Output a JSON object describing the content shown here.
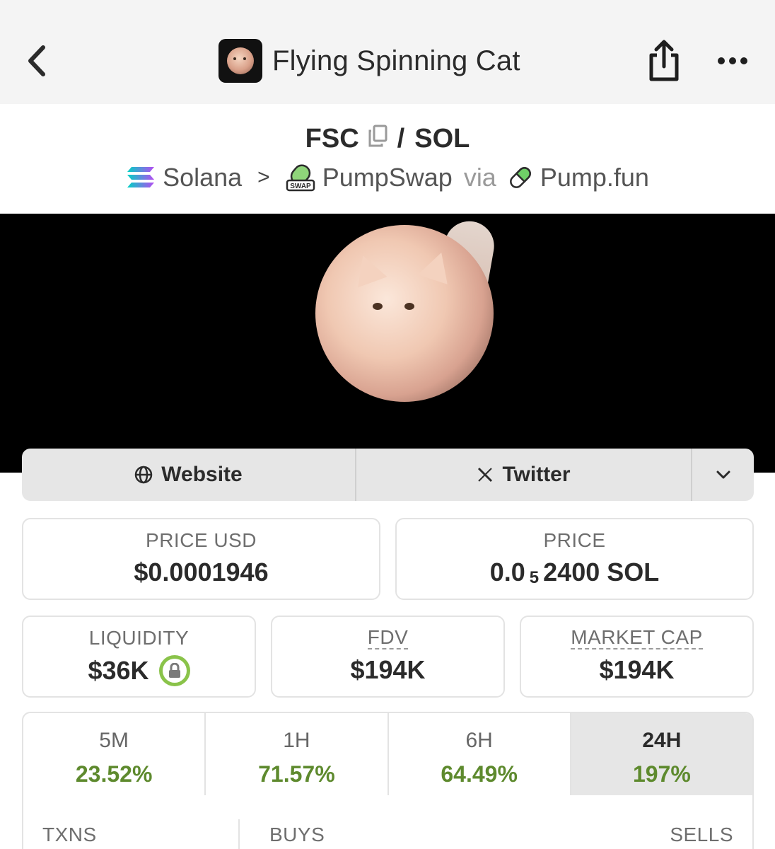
{
  "header": {
    "title": "Flying Spinning Cat"
  },
  "pair": {
    "base": "FSC",
    "separator": "/",
    "quote": "SOL"
  },
  "chain_row": {
    "chain": "Solana",
    "dex": "PumpSwap",
    "via_label": "via",
    "launchpad": "Pump.fun",
    "dex_badge_text": "SWAP"
  },
  "social": {
    "website_label": "Website",
    "twitter_label": "Twitter"
  },
  "stats": {
    "price_usd_label": "PRICE USD",
    "price_usd_value": "$0.0001946",
    "price_label": "PRICE",
    "price_prefix": "0.0",
    "price_zero_count": "5",
    "price_digits": "2400 SOL",
    "liquidity_label": "LIQUIDITY",
    "liquidity_value": "$36K",
    "fdv_label": "FDV",
    "fdv_value": "$194K",
    "mcap_label": "MARKET CAP",
    "mcap_value": "$194K"
  },
  "timeframes": [
    {
      "label": "5M",
      "value": "23.52%"
    },
    {
      "label": "1H",
      "value": "71.57%"
    },
    {
      "label": "6H",
      "value": "64.49%"
    },
    {
      "label": "24H",
      "value": "197%"
    }
  ],
  "timeframe_active": "24H",
  "txns": {
    "txns_label": "TXNS",
    "buys_label": "BUYS",
    "sells_label": "SELLS"
  },
  "colors": {
    "positive": "#5e8a2e",
    "lock_green": "#8ac34a",
    "header_bg": "#f4f4f4"
  },
  "icons": [
    "back-chevron-icon",
    "share-icon",
    "more-dots-icon",
    "copy-icon",
    "solana-icon",
    "chevron-right-icon",
    "pumpswap-icon",
    "pill-icon",
    "globe-icon",
    "x-logo-icon",
    "chevron-down-icon",
    "lock-icon"
  ]
}
